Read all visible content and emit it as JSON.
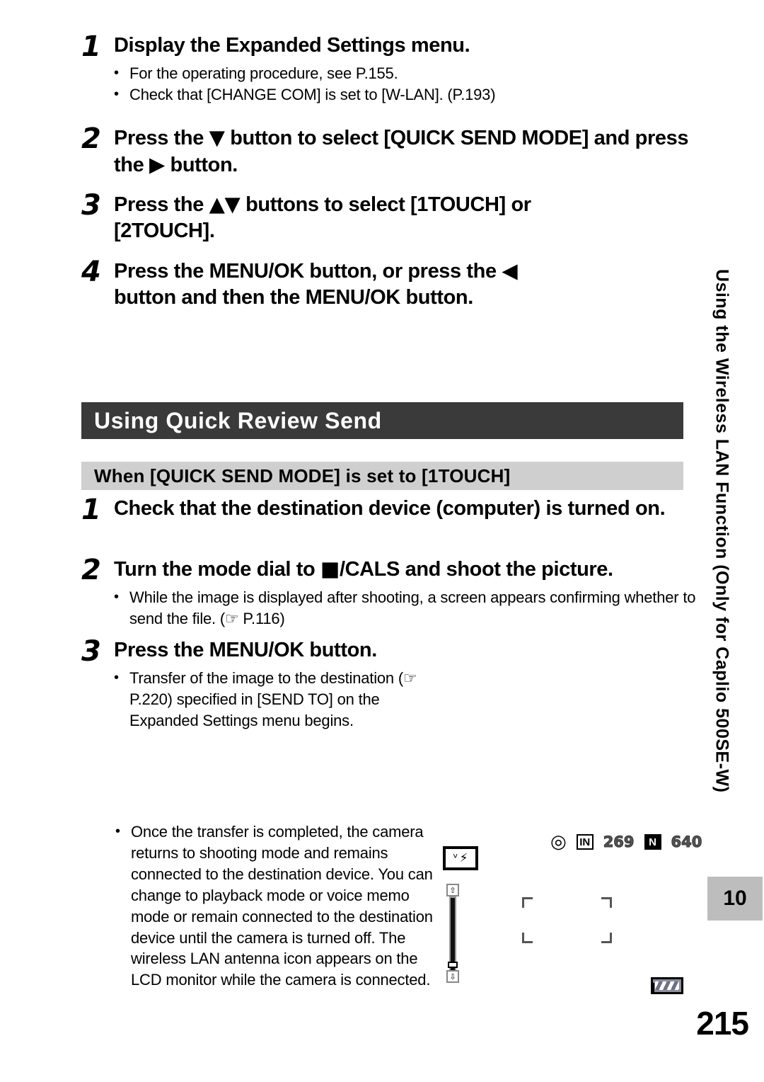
{
  "document": {
    "page_number": "215",
    "chapter_number": "10",
    "side_tab_text": "Using the Wireless LAN Function (Only for Caplio 500SE-W)"
  },
  "steps_top": [
    {
      "num": "1",
      "title": "Display the Expanded Settings menu.",
      "bullets": [
        "For the operating procedure, see P.155.",
        "Check that [CHANGE COM] is set to [W-LAN]. (P.193)"
      ]
    },
    {
      "num": "2",
      "title_part1": "Press the ",
      "glyph1": "▼",
      "title_part2": " button to select [QUICK SEND MODE] and press the ",
      "glyph2": "▶",
      "title_part3": " button.",
      "bullets": []
    },
    {
      "num": "3",
      "title_part1": "Press the ",
      "glyph1": "▲▼",
      "title_part2": " buttons to select [1TOUCH] or [2TOUCH].",
      "bullets": []
    },
    {
      "num": "4",
      "title_part1": "Press the MENU/OK button, or press the ",
      "glyph1": "◀",
      "title_part2": " button and then the MENU/OK button.",
      "bullets": []
    }
  ],
  "section": {
    "heading": "Using Quick Review Send",
    "subheading": "When [QUICK SEND MODE] is set to [1TOUCH]"
  },
  "steps_bottom": [
    {
      "num": "1",
      "title": "Check that the destination device (computer) is turned on.",
      "bullets": []
    },
    {
      "num": "2",
      "title_part1": "Turn the mode dial to ",
      "glyph1": "■",
      "title_part2": "/CALS and shoot the picture.",
      "bullets": [
        "While the image is displayed after shooting, a screen appears confirming whether to send the file. (☞ P.116)"
      ]
    },
    {
      "num": "3",
      "title": "Press the MENU/OK button.",
      "bullets": [
        "Transfer of the image to the destination (☞ P.220) specified in [SEND TO] on the Expanded Settings menu begins."
      ]
    }
  ],
  "final_note": {
    "bullet": "Once the transfer is completed, the camera returns to shooting mode and remains connected to the destination device. You can change to playback mode or voice memo mode or remain connected to the destination device until the camera is turned off. The wireless LAN antenna icon appears on the LCD monitor while the camera is connected."
  },
  "lcd_illustration": {
    "antenna_glyph": "ᵛ",
    "flash_glyph": "⚡",
    "camera_glyph": "◎",
    "memory_label": "IN",
    "shots_remaining": "269",
    "quality_label": "N",
    "image_size": "640",
    "zoom_tele_glyph": "⇧",
    "zoom_wide_glyph": "⇩"
  },
  "colors": {
    "bar_dark": "#3a3a3a",
    "bar_gray": "#cfcfcf",
    "chapter_gray": "#bdbdbd"
  }
}
